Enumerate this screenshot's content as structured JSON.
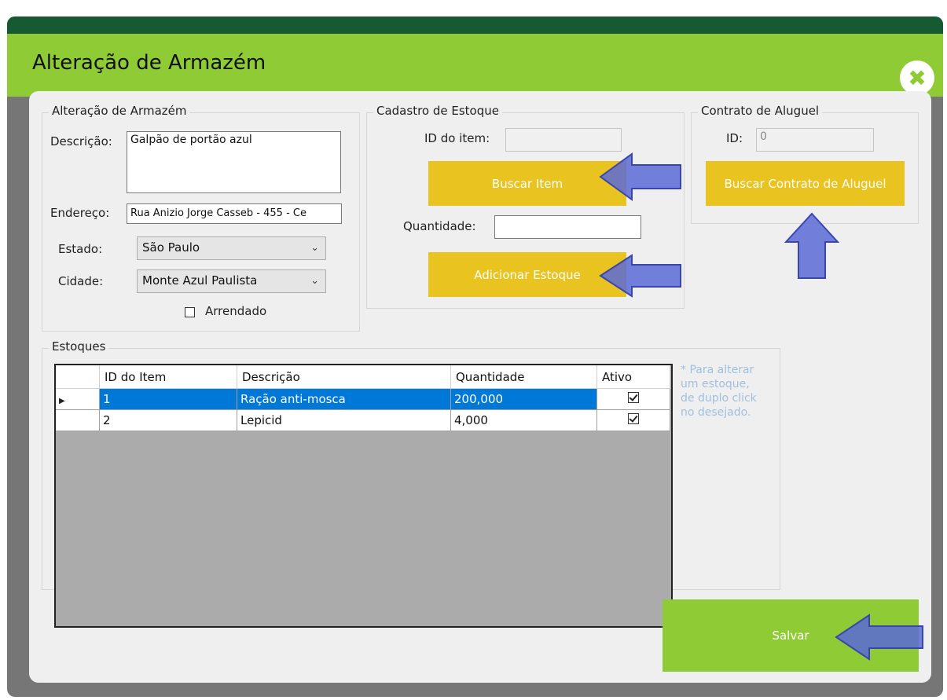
{
  "window": {
    "title": "Alteração de Armazém",
    "close_icon": "close-icon"
  },
  "armazem": {
    "legend": "Alteração de Armazém",
    "descricao_label": "Descrição:",
    "descricao_value": "Galpão de portão azul",
    "endereco_label": "Endereço:",
    "endereco_value": "Rua Anizio Jorge Casseb - 455 - Ce",
    "estado_label": "Estado:",
    "estado_value": "São Paulo",
    "cidade_label": "Cidade:",
    "cidade_value": "Monte Azul Paulista",
    "arrendado_label": "Arrendado"
  },
  "estoque": {
    "legend": "Cadastro de Estoque",
    "id_label": "ID do item:",
    "id_value": "",
    "buscar_label": "Buscar Item",
    "quantidade_label": "Quantidade:",
    "quantidade_value": "",
    "adicionar_label": "Adicionar Estoque"
  },
  "contrato": {
    "legend": "Contrato de Aluguel",
    "id_label": "ID:",
    "id_value": "0",
    "buscar_label": "Buscar Contrato de Aluguel"
  },
  "estoques": {
    "legend": "Estoques",
    "columns": [
      "ID do Item",
      "Descrição",
      "Quantidade",
      "Ativo"
    ],
    "rows": [
      {
        "id": "1",
        "descricao": "Ração anti-mosca",
        "quantidade": "200,000",
        "ativo": true,
        "selected": true
      },
      {
        "id": "2",
        "descricao": "Lepicid",
        "quantidade": "4,000",
        "ativo": true,
        "selected": false
      }
    ],
    "hint_lines": [
      "* Para alterar",
      "um estoque,",
      "de duplo click",
      "no desejado."
    ]
  },
  "salvar_label": "Salvar",
  "colors": {
    "accent_green": "#8fcb35",
    "dark_green": "#155a30",
    "button_yellow": "#e9c31f",
    "arrow_blue": "#5a6ad6",
    "selection_blue": "#0078d7"
  }
}
